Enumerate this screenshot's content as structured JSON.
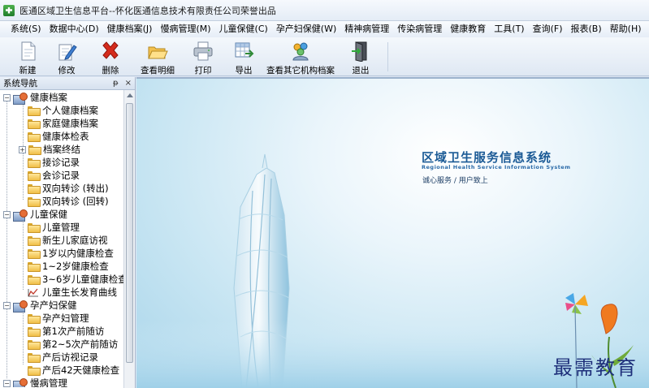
{
  "window": {
    "title": "医通区域卫生信息平台--怀化医通信息技术有限责任公司荣誉出品"
  },
  "menu": [
    {
      "label": "系统(S)"
    },
    {
      "label": "数据中心(D)"
    },
    {
      "label": "健康档案(J)"
    },
    {
      "label": "慢病管理(M)"
    },
    {
      "label": "儿童保健(C)"
    },
    {
      "label": "孕产妇保健(W)"
    },
    {
      "label": "精神病管理"
    },
    {
      "label": "传染病管理"
    },
    {
      "label": "健康教育"
    },
    {
      "label": "工具(T)"
    },
    {
      "label": "查询(F)"
    },
    {
      "label": "报表(B)"
    },
    {
      "label": "帮助(H)"
    }
  ],
  "toolbar": {
    "new": "新建",
    "edit": "修改",
    "delete": "删除",
    "view_detail": "查看明细",
    "print": "打印",
    "export": "导出",
    "view_other": "查看其它机构档案",
    "exit": "退出"
  },
  "nav": {
    "title": "系统导航",
    "pin": "ᵽ",
    "close": "×",
    "groups": [
      {
        "label": "健康档案",
        "expanded": true,
        "items": [
          {
            "label": "个人健康档案"
          },
          {
            "label": "家庭健康档案"
          },
          {
            "label": "健康体检表"
          },
          {
            "label": "档案终结",
            "expandable": true
          },
          {
            "label": "接诊记录"
          },
          {
            "label": "会诊记录"
          },
          {
            "label": "双向转诊 (转出)"
          },
          {
            "label": "双向转诊 (回转)"
          }
        ]
      },
      {
        "label": "儿童保健",
        "expanded": true,
        "items": [
          {
            "label": "儿童管理"
          },
          {
            "label": "新生儿家庭访视"
          },
          {
            "label": "1岁以内健康检查"
          },
          {
            "label": "1~2岁健康检查"
          },
          {
            "label": "3~6岁儿童健康检查"
          },
          {
            "label": "儿童生长发育曲线",
            "icon": "chart"
          }
        ]
      },
      {
        "label": "孕产妇保健",
        "expanded": true,
        "items": [
          {
            "label": "孕产妇管理"
          },
          {
            "label": "第1次产前随访"
          },
          {
            "label": "第2~5次产前随访"
          },
          {
            "label": "产后访视记录"
          },
          {
            "label": "产后42天健康检查"
          }
        ]
      },
      {
        "label": "慢病管理",
        "expanded": false,
        "items": []
      }
    ]
  },
  "splash": {
    "title": "区域卫生服务信息系统",
    "subtitle": "Regional Health Service Information System",
    "slogan": "诚心服务 / 用户致上"
  },
  "watermark": "最需教育",
  "colors": {
    "menu_bg": "#e6edf7",
    "splash_title": "#1c5b96",
    "splash_bg": "#c9e6f3",
    "delete_icon": "#d42b1c"
  }
}
